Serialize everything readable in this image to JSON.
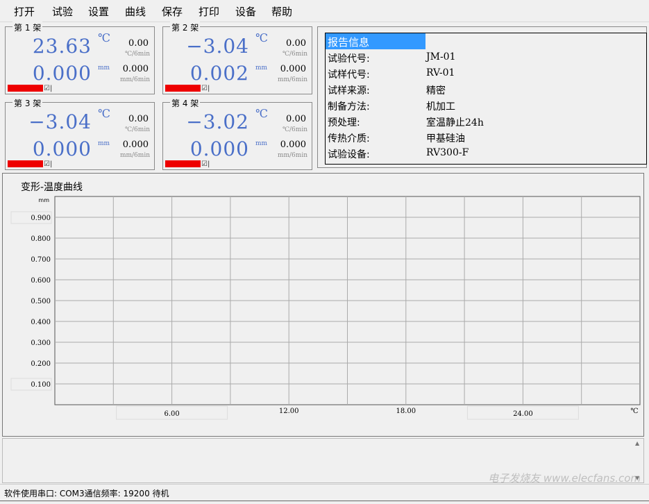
{
  "menu": [
    "打开",
    "试验",
    "设置",
    "曲线",
    "保存",
    "打印",
    "设备",
    "帮助"
  ],
  "racks": [
    {
      "title": "第 1 架",
      "temp": "23.63",
      "temp_unit": "℃",
      "temp_rate": "0.00",
      "temp_rate_unit": "℃/6min",
      "def": "0.000",
      "def_unit": "mm",
      "def_rate": "0.000",
      "def_rate_unit": "mm/6min",
      "check": "☑|"
    },
    {
      "title": "第 2 架",
      "temp": "−3.04",
      "temp_unit": "℃",
      "temp_rate": "0.00",
      "temp_rate_unit": "℃/6min",
      "def": "0.002",
      "def_unit": "mm",
      "def_rate": "0.000",
      "def_rate_unit": "mm/6min",
      "check": "☑|"
    },
    {
      "title": "第 3 架",
      "temp": "−3.04",
      "temp_unit": "℃",
      "temp_rate": "0.00",
      "temp_rate_unit": "℃/6min",
      "def": "0.000",
      "def_unit": "mm",
      "def_rate": "0.000",
      "def_rate_unit": "mm/6min",
      "check": "☑|"
    },
    {
      "title": "第 4 架",
      "temp": "−3.02",
      "temp_unit": "℃",
      "temp_rate": "0.00",
      "temp_rate_unit": "℃/6min",
      "def": "0.000",
      "def_unit": "mm",
      "def_rate": "0.000",
      "def_rate_unit": "mm/6min",
      "check": "☑|"
    }
  ],
  "report": {
    "header": "报告信息",
    "rows": [
      {
        "label": "试验代号:",
        "value": "JM-01"
      },
      {
        "label": "试样代号:",
        "value": "RV-01"
      },
      {
        "label": "试样来源:",
        "value": "精密"
      },
      {
        "label": "制备方法:",
        "value": "机加工"
      },
      {
        "label": "预处理:",
        "value": "室温静止24h"
      },
      {
        "label": "传热介质:",
        "value": "甲基硅油"
      },
      {
        "label": "试验设备:",
        "value": "RV300-F"
      }
    ]
  },
  "chart_data": {
    "type": "line",
    "title": "变形-温度曲线",
    "ylabel": "mm",
    "xlabel": "℃",
    "xlim": [
      0,
      30
    ],
    "ylim": [
      0,
      1
    ],
    "xticks": [
      "6.00",
      "12.00",
      "18.00",
      "24.00"
    ],
    "xtick_values": [
      6,
      12,
      18,
      24
    ],
    "yticks": [
      "0.900",
      "0.800",
      "0.700",
      "0.600",
      "0.500",
      "0.400",
      "0.300",
      "0.200",
      "0.100"
    ],
    "ytick_values": [
      0.9,
      0.8,
      0.7,
      0.6,
      0.5,
      0.4,
      0.3,
      0.2,
      0.1
    ],
    "grid": true,
    "series": []
  },
  "status": "软件使用串口: COM3通信频率: 19200  待机",
  "watermark": "电子发烧友 www.elecfans.com"
}
